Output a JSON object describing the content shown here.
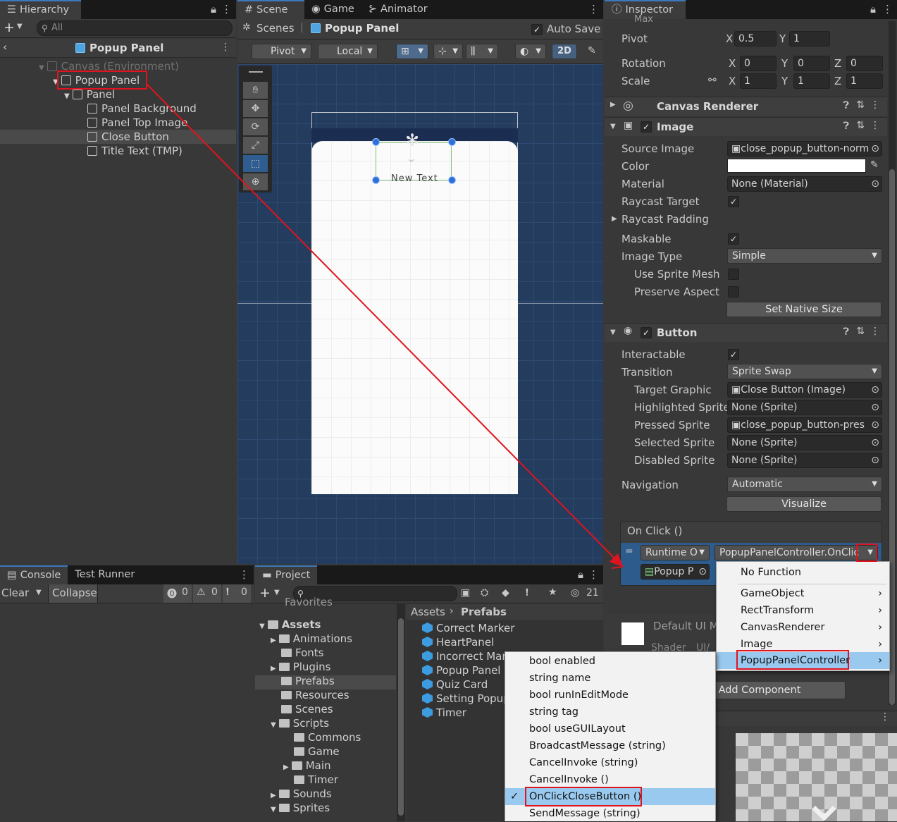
{
  "hierarchy": {
    "tab": "Hierarchy",
    "search_placeholder": "All",
    "title": "Popup Panel",
    "items": [
      {
        "label": "Canvas (Environment)"
      },
      {
        "label": "Popup Panel"
      },
      {
        "label": "Panel"
      },
      {
        "label": "Panel Background"
      },
      {
        "label": "Panel Top Image"
      },
      {
        "label": "Close Button"
      },
      {
        "label": "Title Text (TMP)"
      }
    ]
  },
  "scene": {
    "tabs": [
      "Scene",
      "Game",
      "Animator"
    ],
    "breadcrumb_root": "Scenes",
    "breadcrumb_current": "Popup Panel",
    "auto_save": "Auto Save",
    "pivot": "Pivot",
    "local": "Local",
    "mode_2d": "2D",
    "canvas_text": "New Text"
  },
  "inspector": {
    "tab": "Inspector",
    "max_label": "Max",
    "max_x": "0.5",
    "max_y": "1",
    "pivot_label": "Pivot",
    "pivot_x": "0.5",
    "pivot_y": "1",
    "rotation_label": "Rotation",
    "rot_x": "0",
    "rot_y": "0",
    "rot_z": "0",
    "scale_label": "Scale",
    "scale_x": "1",
    "scale_y": "1",
    "scale_z": "1",
    "canvas_renderer": "Canvas Renderer",
    "image": {
      "title": "Image",
      "source_image_label": "Source Image",
      "source_image": "close_popup_button-norm",
      "color_label": "Color",
      "material_label": "Material",
      "material": "None (Material)",
      "raycast_target": "Raycast Target",
      "raycast_padding": "Raycast Padding",
      "maskable": "Maskable",
      "image_type_label": "Image Type",
      "image_type": "Simple",
      "use_sprite_mesh": "Use Sprite Mesh",
      "preserve_aspect": "Preserve Aspect",
      "set_native_size": "Set Native Size"
    },
    "button": {
      "title": "Button",
      "interactable": "Interactable",
      "transition_label": "Transition",
      "transition": "Sprite Swap",
      "target_graphic_label": "Target Graphic",
      "target_graphic": "Close Button (Image)",
      "highlighted_label": "Highlighted Sprite",
      "highlighted": "None (Sprite)",
      "pressed_label": "Pressed Sprite",
      "pressed": "close_popup_button-pres",
      "selected_label": "Selected Sprite",
      "selected": "None (Sprite)",
      "disabled_label": "Disabled Sprite",
      "disabled": "None (Sprite)",
      "navigation_label": "Navigation",
      "navigation": "Automatic",
      "visualize": "Visualize"
    },
    "onclick": {
      "title": "On Click ()",
      "runtime": "Runtime O",
      "function": "PopupPanelController.OnClic",
      "object": "Popup P"
    },
    "material_name": "Default UI M",
    "shader_label": "Shader",
    "shader_value": "UI/",
    "add_component": "Add Component"
  },
  "console": {
    "tabs": [
      "Console",
      "Test Runner"
    ],
    "clear": "Clear",
    "collapse": "Collapse",
    "errors": "0",
    "warnings": "0",
    "messages": "0"
  },
  "project": {
    "tab": "Project",
    "count": "21",
    "breadcrumb_root": "Assets",
    "breadcrumb_current": "Prefabs",
    "favorites": "Favorites",
    "folders": [
      {
        "label": "Assets"
      },
      {
        "label": "Animations"
      },
      {
        "label": "Fonts"
      },
      {
        "label": "Plugins"
      },
      {
        "label": "Prefabs"
      },
      {
        "label": "Resources"
      },
      {
        "label": "Scenes"
      },
      {
        "label": "Scripts"
      },
      {
        "label": "Commons"
      },
      {
        "label": "Game"
      },
      {
        "label": "Main"
      },
      {
        "label": "Timer"
      },
      {
        "label": "Sounds"
      },
      {
        "label": "Sprites"
      }
    ],
    "assets": [
      {
        "label": "Correct Marker"
      },
      {
        "label": "HeartPanel"
      },
      {
        "label": "Incorrect Mar"
      },
      {
        "label": "Popup Panel"
      },
      {
        "label": "Quiz Card"
      },
      {
        "label": "Setting Popup"
      },
      {
        "label": "Timer"
      }
    ]
  },
  "function_menu": {
    "items": [
      {
        "label": "No Function"
      },
      {
        "label": "GameObject"
      },
      {
        "label": "RectTransform"
      },
      {
        "label": "CanvasRenderer"
      },
      {
        "label": "Image"
      },
      {
        "label": "PopupPanelController"
      }
    ]
  },
  "method_menu": {
    "items": [
      {
        "label": "bool enabled"
      },
      {
        "label": "string name"
      },
      {
        "label": "bool runInEditMode"
      },
      {
        "label": "string tag"
      },
      {
        "label": "bool useGUILayout"
      },
      {
        "label": "BroadcastMessage (string)"
      },
      {
        "label": "CancelInvoke (string)"
      },
      {
        "label": "CancelInvoke ()"
      },
      {
        "label": "OnClickCloseButton ()"
      },
      {
        "label": "SendMessage (string)"
      }
    ]
  },
  "colors": {
    "accent": "#3a79bb",
    "highlight": "#99c9ef",
    "annotation": "#e0141e",
    "scene_bg": "#243c5e"
  }
}
